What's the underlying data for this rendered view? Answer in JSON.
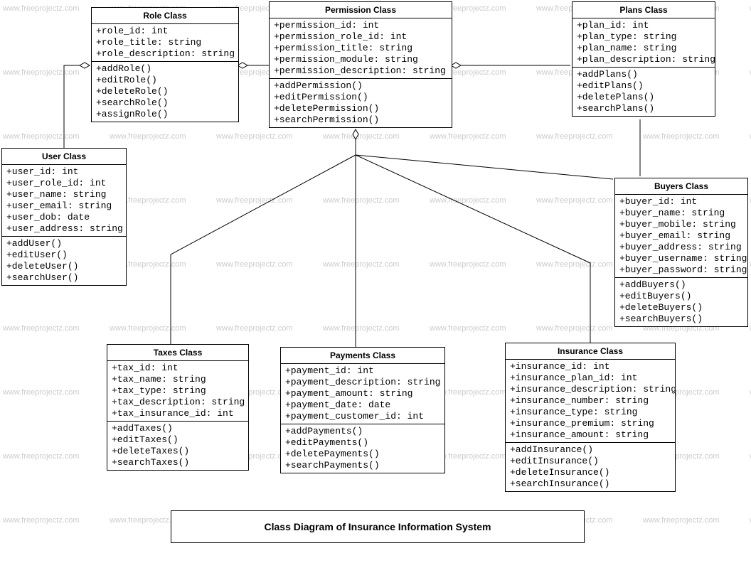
{
  "title": "Class Diagram of Insurance Information System",
  "watermark": "www.freeprojectz.com",
  "classes": {
    "role": {
      "name": "Role Class",
      "attrs": [
        "+role_id: int",
        "+role_title: string",
        "+role_description: string"
      ],
      "methods": [
        "+addRole()",
        "+editRole()",
        "+deleteRole()",
        "+searchRole()",
        "+assignRole()"
      ]
    },
    "permission": {
      "name": "Permission Class",
      "attrs": [
        "+permission_id: int",
        "+permission_role_id: int",
        "+permission_title: string",
        "+permission_module: string",
        "+permission_description: string"
      ],
      "methods": [
        "+addPermission()",
        "+editPermission()",
        "+deletePermission()",
        "+searchPermission()"
      ]
    },
    "plans": {
      "name": "Plans Class",
      "attrs": [
        "+plan_id: int",
        "+plan_type: string",
        "+plan_name: string",
        "+plan_description: string"
      ],
      "methods": [
        "+addPlans()",
        "+editPlans()",
        "+deletePlans()",
        "+searchPlans()"
      ]
    },
    "user": {
      "name": "User Class",
      "attrs": [
        "+user_id: int",
        "+user_role_id: int",
        "+user_name: string",
        "+user_email: string",
        "+user_dob: date",
        "+user_address: string"
      ],
      "methods": [
        "+addUser()",
        "+editUser()",
        "+deleteUser()",
        "+searchUser()"
      ]
    },
    "buyers": {
      "name": "Buyers Class",
      "attrs": [
        "+buyer_id: int",
        "+buyer_name: string",
        "+buyer_mobile: string",
        "+buyer_email: string",
        "+buyer_address: string",
        "+buyer_username: string",
        "+buyer_password: string"
      ],
      "methods": [
        "+addBuyers()",
        "+editBuyers()",
        "+deleteBuyers()",
        "+searchBuyers()"
      ]
    },
    "taxes": {
      "name": "Taxes Class",
      "attrs": [
        "+tax_id: int",
        "+tax_name: string",
        "+tax_type: string",
        "+tax_description: string",
        "+tax_insurance_id: int"
      ],
      "methods": [
        "+addTaxes()",
        "+editTaxes()",
        "+deleteTaxes()",
        "+searchTaxes()"
      ]
    },
    "payments": {
      "name": "Payments Class",
      "attrs": [
        "+payment_id: int",
        "+payment_description: string",
        "+payment_amount: string",
        "+payment_date: date",
        "+payment_customer_id: int"
      ],
      "methods": [
        "+addPayments()",
        "+editPayments()",
        "+deletePayments()",
        "+searchPayments()"
      ]
    },
    "insurance": {
      "name": "Insurance Class",
      "attrs": [
        "+insurance_id: int",
        "+insurance_plan_id: int",
        "+insurance_description: string",
        "+insurance_number: string",
        "+insurance_type: string",
        "+insurance_premium: string",
        "+insurance_amount: string"
      ],
      "methods": [
        "+addInsurance()",
        "+editInsurance()",
        "+deleteInsurance()",
        "+searchInsurance()"
      ]
    }
  }
}
